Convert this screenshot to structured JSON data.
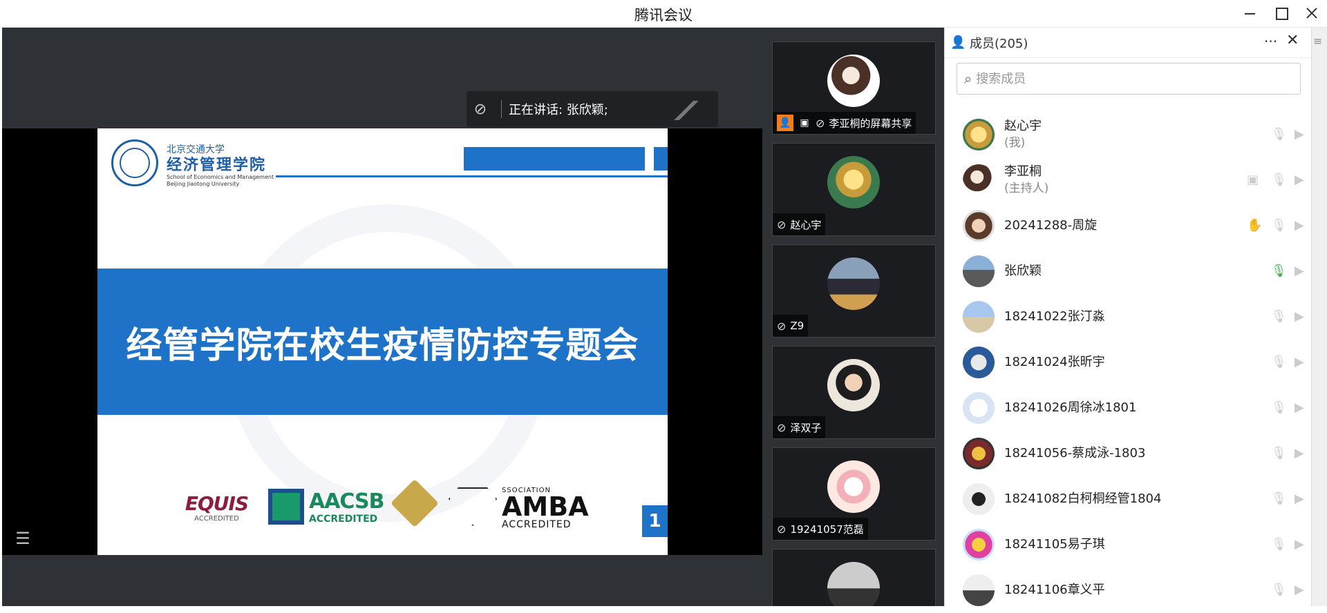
{
  "window": {
    "title": "腾讯会议"
  },
  "speaker": {
    "text": "正在讲话: 张欣颖;"
  },
  "slide": {
    "school_cn": "北京交通大学",
    "school_college": "经济管理学院",
    "school_en1": "School of Economics and Management",
    "school_en2": "Beijing Jiaotong University",
    "title": "经管学院在校生疫情防控专题会",
    "equis": "EQUIS",
    "equis_sub": "ACCREDITED",
    "aacsb": "AACSB",
    "aacsb_sub": "ACCREDITED",
    "amba_top": "SSOCIATION",
    "amba": "AMBA",
    "amba_sub": "ACCREDITED",
    "page": "1"
  },
  "videos": [
    {
      "label": "李亚桐的屏幕共享"
    },
    {
      "label": "赵心宇"
    },
    {
      "label": "Z9"
    },
    {
      "label": "泽双子"
    },
    {
      "label": "19241057范磊"
    }
  ],
  "members": {
    "title": "成员(205)",
    "search_placeholder": "搜索成员",
    "list": [
      {
        "name": "赵心宇",
        "sub": "(我)"
      },
      {
        "name": "李亚桐",
        "sub": "(主持人)"
      },
      {
        "name": "20241288-周旋",
        "sub": ""
      },
      {
        "name": "张欣颖",
        "sub": ""
      },
      {
        "name": "18241022张汀淼",
        "sub": ""
      },
      {
        "name": "18241024张昕宇",
        "sub": ""
      },
      {
        "name": "18241026周徐冰1801",
        "sub": ""
      },
      {
        "name": "18241056-蔡成泳-1803",
        "sub": ""
      },
      {
        "name": "18241082白柯桐经管1804",
        "sub": ""
      },
      {
        "name": "18241105易子琪",
        "sub": ""
      },
      {
        "name": "18241106章义平",
        "sub": ""
      }
    ]
  }
}
